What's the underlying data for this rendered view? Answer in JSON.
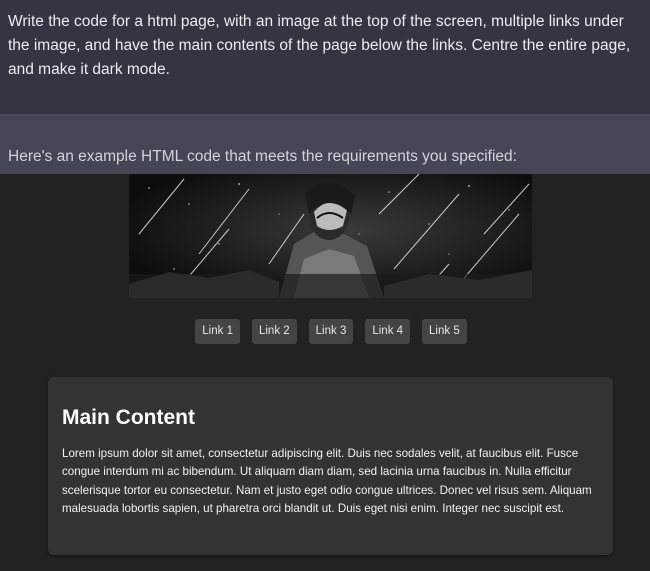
{
  "conversation": {
    "user_prompt": "Write the code for a html page, with an image at the top of the screen, multiple links under the image, and have the main contents of the page below the links. Centre the entire page, and make it dark mode.",
    "assistant_intro": "Here's an example HTML code that meets the requirements you specified:"
  },
  "preview": {
    "links": [
      "Link 1",
      "Link 2",
      "Link 3",
      "Link 4",
      "Link 5"
    ],
    "main_heading": "Main Content",
    "main_body": "Lorem ipsum dolor sit amet, consectetur adipiscing elit. Duis nec sodales velit, at faucibus elit. Fusce congue interdum mi ac bibendum. Ut aliquam diam diam, sed lacinia urna faucibus in. Nulla efficitur scelerisque tortor eu consectetur. Nam et justo eget odio congue ultrices. Donec vel risus sem. Aliquam malesuada lobortis sapien, ut pharetra orci blandit ut. Duis eget nisi enim. Integer nec suscipit est."
  },
  "colors": {
    "prompt_bg": "#343541",
    "reply_bg": "#444654",
    "page_bg": "#222222",
    "card_bg": "#333333",
    "link_bg": "#444444"
  }
}
